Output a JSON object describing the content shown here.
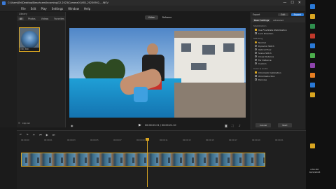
{
  "titlebar": {
    "title": "C:\\Users\\Bri\\Desktop\\Beachcam\\Incoming\\12-2023\\Camera01\\VID_20230902_...INSV",
    "minimize": "—",
    "maximize": "☐",
    "close": "✕"
  },
  "menu": {
    "items": [
      "File",
      "Edit",
      "Play",
      "Settings",
      "Window",
      "Help"
    ]
  },
  "library": {
    "header": "Library",
    "tabs": [
      "All",
      "Photos",
      "Videos",
      "Favorites"
    ],
    "thumb_caption": "VID_360",
    "footer_label": "Clip list"
  },
  "preview_toolbar": {
    "left_label": "Video",
    "right_label": "Reframe"
  },
  "transport": {
    "timecode": "00:00:03.21 / 00:00:21.10"
  },
  "right_panel": {
    "tab1": "Export",
    "btn1": "Edit",
    "btn2": "Export",
    "tabs": [
      "Basic Settings",
      "Advanced"
    ],
    "section1": "Stabilization",
    "opt1": "Use FlowState Stabilization",
    "opt2": "Lock Direction",
    "section2": "Stitching",
    "radios": [
      "Normal",
      "Dynamic Stitch",
      "Optical Flow",
      "Scene Stitch",
      "Close Distance",
      "Far Distance",
      "Custom"
    ],
    "section3": "Color & Audio",
    "opt3": "Chromatic Calibration",
    "opt4": "Wind Reduction",
    "opt5": "Denoise",
    "bottom_btns": [
      "Cancel",
      "Start"
    ]
  },
  "timeline": {
    "ticks": [
      "00:00:00",
      "00:00:01",
      "00:00:03",
      "00:00:05",
      "00:00:07",
      "00:00:09",
      "00:00:11",
      "00:00:13",
      "00:00:15",
      "00:00:17",
      "00:00:19",
      "00:00:21"
    ]
  },
  "taskbar": {
    "time": "4:56 PM",
    "date": "6/22/2023"
  }
}
